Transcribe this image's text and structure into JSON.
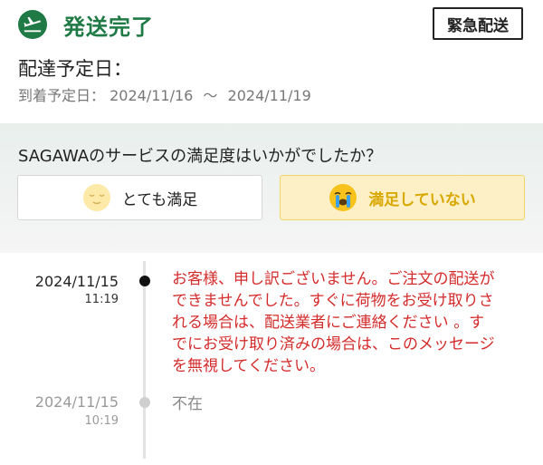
{
  "status": {
    "title": "発送完了",
    "icon": "airplane-icon",
    "color": "#1f7a45"
  },
  "urgent_button": {
    "label": "緊急配送"
  },
  "delivery": {
    "scheduled_label": "配達予定日：",
    "arrival_label": "到着予定日：",
    "arrival_start": "2024/11/16",
    "arrival_separator": "～",
    "arrival_end": "2024/11/19"
  },
  "survey": {
    "question": "SAGAWAのサービスの満足度はいかがでしたか？",
    "satisfied": {
      "label": "とても満足",
      "icon": "smiling-face-icon"
    },
    "unsatisfied": {
      "label": "満足していない",
      "icon": "crying-face-icon",
      "accent": "#d9a800"
    }
  },
  "timeline": [
    {
      "date": "2024/11/15",
      "time": "11:19",
      "text": "お客様、申し訳ございません。ご注文の配送が\nできませんでした。すぐに荷物をお受け取りさ\nれる場合は、配送業者にご連絡ください 。す\nでにお受け取り済みの場合は、このメッセージ\nを無視してください。",
      "color": "#d42b2b"
    },
    {
      "date": "2024/11/15",
      "time": "10:19",
      "text": "不在"
    }
  ]
}
